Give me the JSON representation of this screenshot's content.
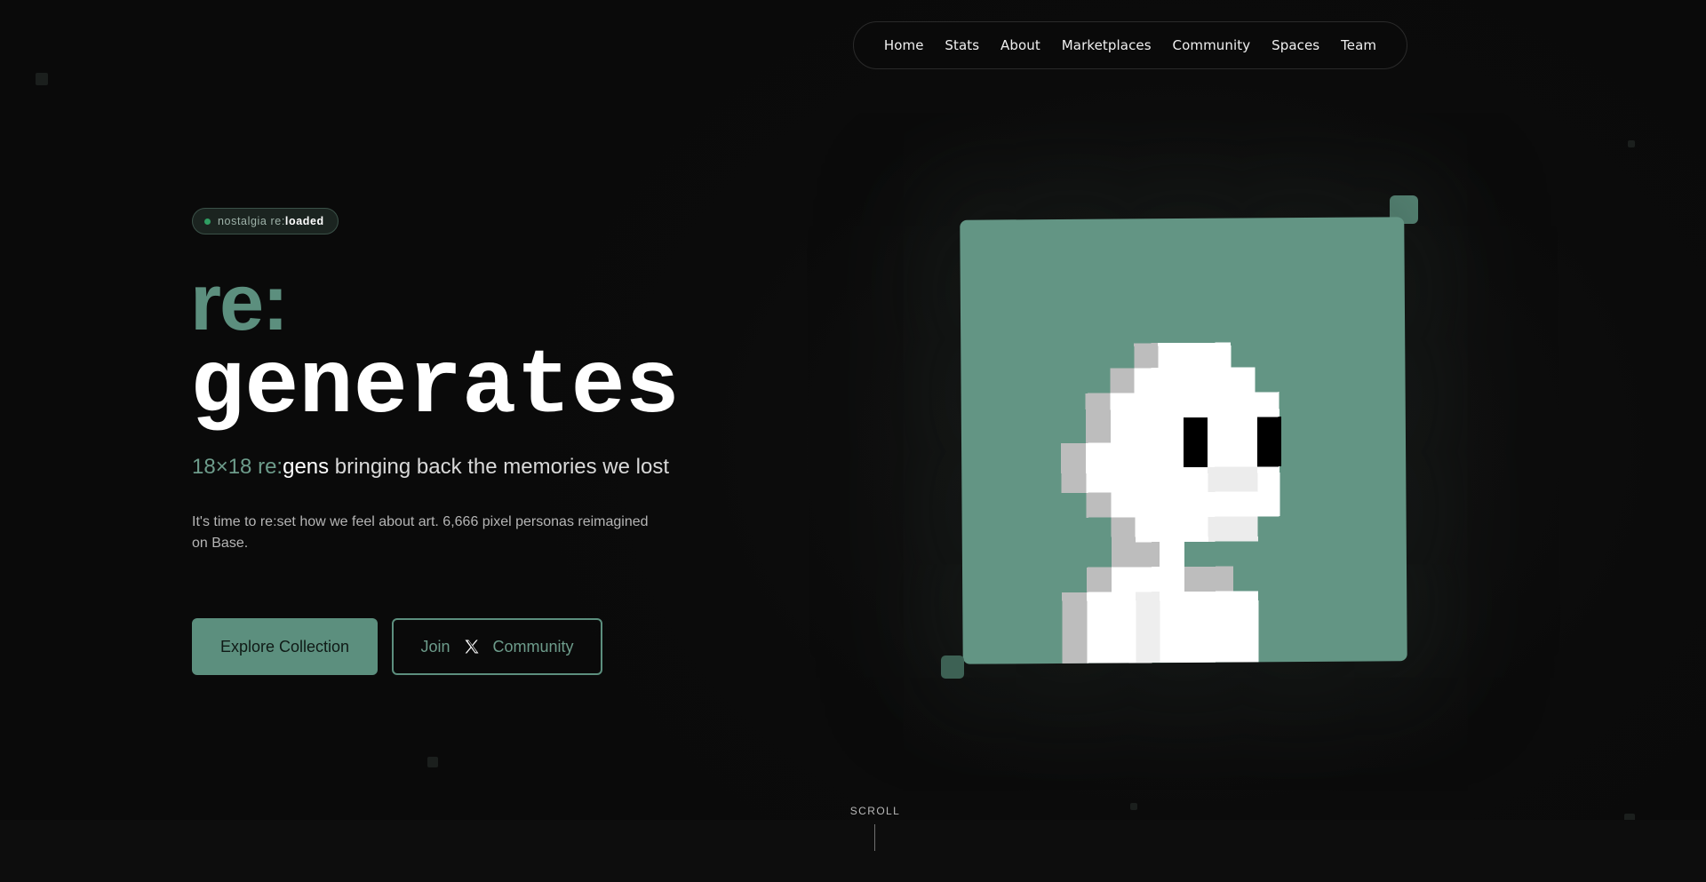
{
  "nav": {
    "items": [
      {
        "label": "Home"
      },
      {
        "label": "Stats"
      },
      {
        "label": "About"
      },
      {
        "label": "Marketplaces"
      },
      {
        "label": "Community"
      },
      {
        "label": "Spaces"
      },
      {
        "label": "Team"
      }
    ]
  },
  "hero": {
    "badge_prefix": "nostalgia re:",
    "badge_bold": "loaded",
    "title_prefix": "re:",
    "title": "generates",
    "subtitle_accent": "18×18 re:",
    "subtitle_strong": "gens",
    "subtitle_rest": " bringing back the memories we lost",
    "description": "It's time to re:set how we feel about art. 6,666 pixel personas reimagined on Base."
  },
  "buttons": {
    "explore_label": "Explore Collection",
    "join_prefix": "Join",
    "join_suffix": "Community",
    "join_icon": "x-logo-icon"
  },
  "scroll_label": "SCROLL",
  "colors": {
    "accent": "#5c8f7e",
    "card_bg": "#639584",
    "background": "#0b0b0b",
    "badge_dot": "#2f9e62"
  }
}
